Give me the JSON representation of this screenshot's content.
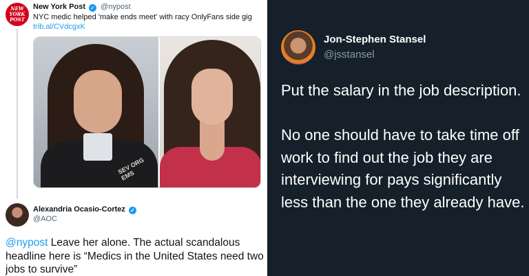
{
  "left": {
    "tweet1": {
      "logo_text": [
        "NEW",
        "YORK",
        "POST"
      ],
      "name": "New York Post",
      "handle": "@nypost",
      "text": "NYC medic helped 'make ends meet' with racy OnlyFans side gig",
      "link": "trib.al/CVdcgxK",
      "media_caption_1": "SEV ORG EMS"
    },
    "tweet2": {
      "name": "Alexandria Ocasio-Cortez",
      "handle": "@AOC",
      "mention": "@nypost",
      "text": " Leave her alone. The actual scandalous headline here is “Medics in the United States need two jobs to survive”"
    }
  },
  "right": {
    "name": "Jon-Stephen Stansel",
    "handle": "@jsstansel",
    "paragraph1": "Put the salary in the job description.",
    "paragraph2": "No one should have to take time off work to find out the job they are interviewing for pays significantly less than the one they already have."
  },
  "colors": {
    "link_blue": "#1d9bf0",
    "dark_bg": "#15202b",
    "nypost_red": "#d0021b"
  }
}
